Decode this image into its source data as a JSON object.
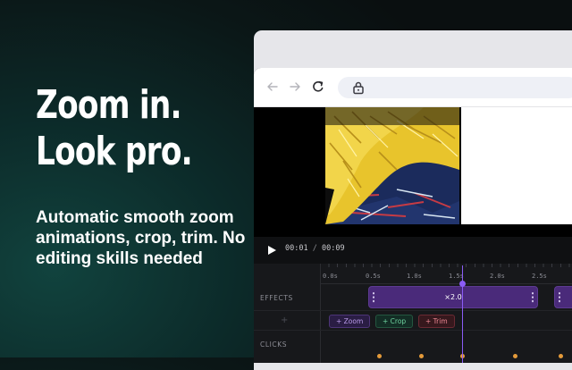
{
  "headline": {
    "line1": "Zoom in.",
    "line2": "Look pro."
  },
  "subtext": "Automatic smooth zoom animations, crop, trim. No editing skills needed",
  "browser": {
    "icons": [
      "back-arrow-icon",
      "forward-arrow-icon",
      "reload-icon",
      "lock-icon"
    ]
  },
  "player": {
    "current_time": "00:01",
    "separator": "/",
    "duration": "00:09"
  },
  "timeline": {
    "ticks": [
      "0.0s",
      "0.5s",
      "1.0s",
      "1.5s",
      "2.0s",
      "2.5s"
    ],
    "rows": {
      "effects": "EFFECTS",
      "clicks": "CLICKS"
    },
    "effect_clip_label": "×2.0",
    "chips": {
      "zoom": "+ Zoom",
      "crop": "+ Crop",
      "trim": "+ Trim"
    },
    "add_icon": "+"
  },
  "colors": {
    "accent_purple": "#8b5cf6",
    "click_marker": "#e49a3a",
    "crop_green": "#6fd4a0",
    "trim_red": "#ee8894"
  }
}
